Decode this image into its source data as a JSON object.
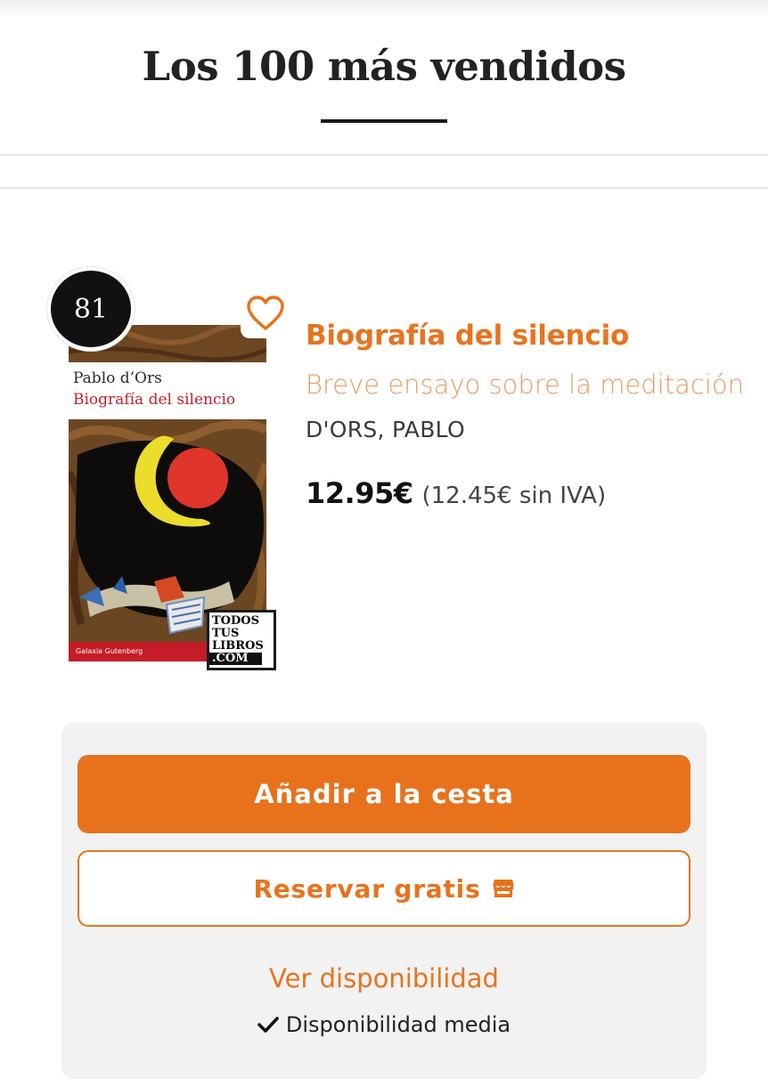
{
  "header": {
    "title": "Los 100 más vendidos"
  },
  "product": {
    "rank": "81",
    "title": "Biografía del silencio",
    "subtitle": "Breve ensayo sobre la meditación",
    "author": "D'ORS, PABLO",
    "price": "12.95€",
    "price_without_vat": "(12.45€ sin IVA)",
    "cover": {
      "author": "Pablo d’Ors",
      "title": "Biografía del silencio",
      "publisher": "Galaxia Gutenberg"
    },
    "watermark": [
      "TODOS",
      "TUS",
      "LIBROS",
      ".COM"
    ]
  },
  "actions": {
    "add_to_cart": "Añadir a la cesta",
    "reserve": "Reservar gratis",
    "check_availability": "Ver disponibilidad",
    "availability_status": "Disponibilidad media"
  },
  "icons": {
    "favorite": "heart-outline-icon",
    "reserve": "store-icon",
    "availability": "check-icon"
  },
  "colors": {
    "accent": "#e8721c",
    "subtitle": "#ec9a62",
    "badge": "#111111",
    "panel": "#f2f2f2"
  }
}
